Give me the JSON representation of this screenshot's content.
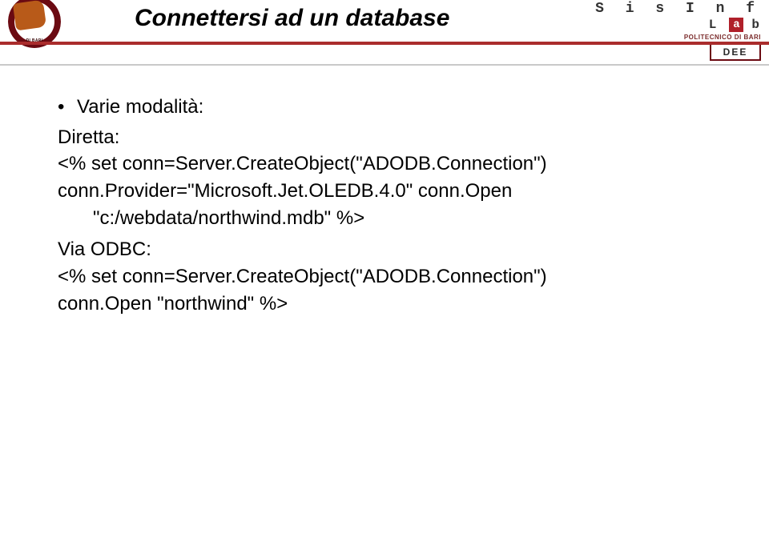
{
  "header": {
    "title": "Connettersi ad un database",
    "left_badge_text": "DI BARI",
    "right_logo": {
      "line1": "S i s I n f",
      "lab_l": "L",
      "lab_a": "a",
      "lab_b": "b",
      "subline": "POLITECNICO DI BARI",
      "dee": "DEE"
    }
  },
  "body": {
    "bullet1": "Varie modalità:",
    "l1": "Diretta:",
    "l2": "<% set conn=Server.CreateObject(\"ADODB.Connection\")",
    "l3": "conn.Provider=\"Microsoft.Jet.OLEDB.4.0\" conn.Open",
    "l4": "\"c:/webdata/northwind.mdb\" %>",
    "l5": "Via ODBC:",
    "l6": "<% set conn=Server.CreateObject(\"ADODB.Connection\")",
    "l7": "conn.Open \"northwind\" %>"
  }
}
